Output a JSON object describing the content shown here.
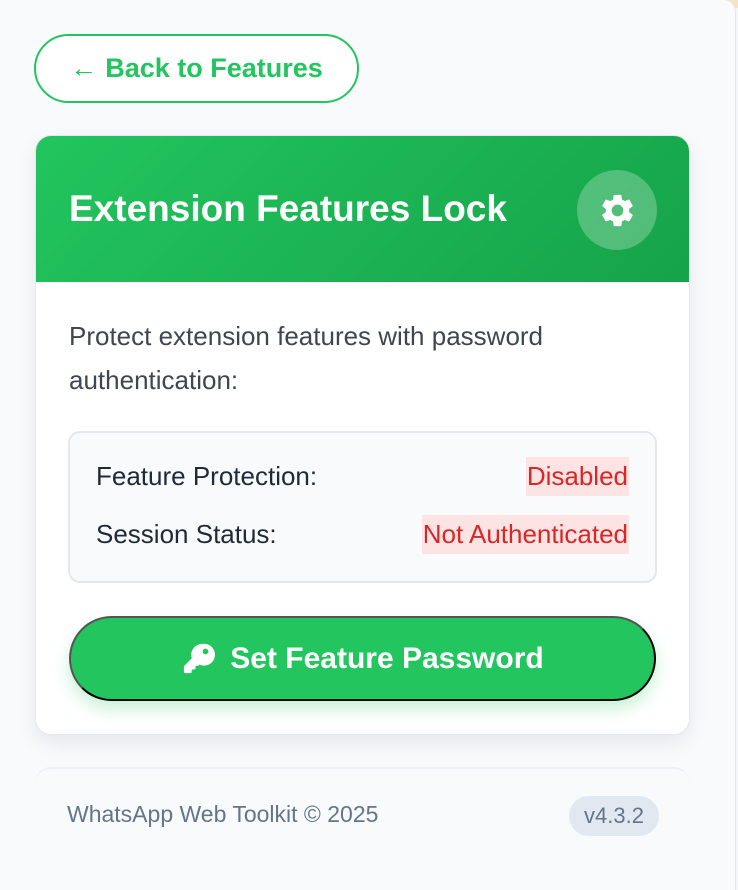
{
  "navigation": {
    "back_label": "Back to Features",
    "back_icon": "arrow-left-icon"
  },
  "card": {
    "title": "Extension Features Lock",
    "settings_icon": "gear-icon",
    "description": "Protect extension features with password authentication:",
    "status": [
      {
        "label": "Feature Protection:",
        "value": "Disabled"
      },
      {
        "label": "Session Status:",
        "value": "Not Authenticated"
      }
    ],
    "primary_action": {
      "label": "Set Feature Password",
      "icon": "key-icon"
    }
  },
  "footer": {
    "text": "WhatsApp Web Toolkit © 2025",
    "version": "v4.3.2"
  },
  "colors": {
    "accent": "#22c55e",
    "accent_dark": "#16a34a",
    "danger": "#dc2626",
    "danger_background": "#fde4e4"
  }
}
